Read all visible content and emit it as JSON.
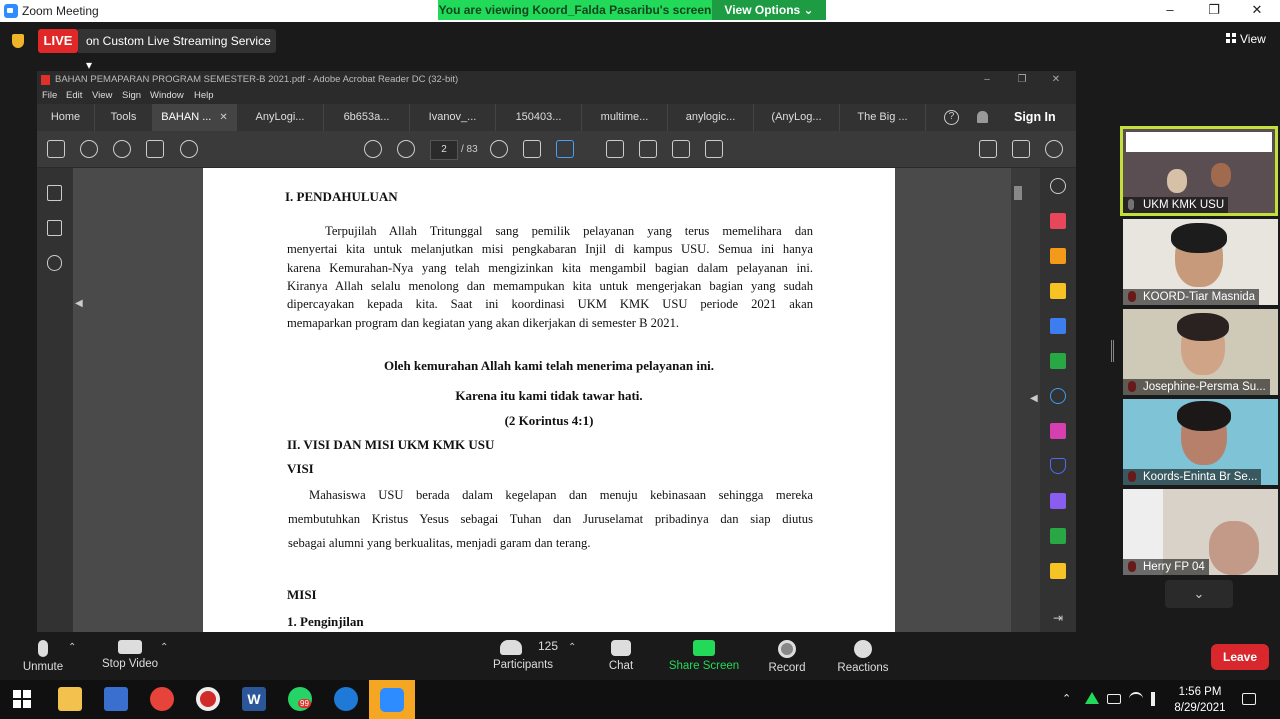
{
  "window": {
    "title": "Zoom Meeting",
    "minimize": "–",
    "restore": "❐",
    "close": "✕"
  },
  "banner": {
    "viewing": "You are viewing Koord_Falda Pasaribu's screen",
    "view_options": "View Options ⌄"
  },
  "live": {
    "badge": "LIVE",
    "stream": "on Custom Live Streaming Service  ▾"
  },
  "view_label": "View",
  "acrobat": {
    "title": "BAHAN PEMAPARAN PROGRAM SEMESTER-B 2021.pdf - Adobe Acrobat Reader DC (32-bit)",
    "menu": [
      "File",
      "Edit",
      "View",
      "Sign",
      "Window",
      "Help"
    ],
    "tabs": [
      "Home",
      "Tools",
      "BAHAN ...",
      "AnyLogi...",
      "6b653a...",
      "Ivanov_...",
      "150403...",
      "multime...",
      "anylogic...",
      "(AnyLog...",
      "The Big ..."
    ],
    "sign_in": "Sign In",
    "page_current": "2",
    "page_total": "/ 83"
  },
  "document": {
    "heading1": "I.  PENDAHULUAN",
    "para1": [
      "Terpujilah Allah Tritunggal sang pemilik pelayanan yang terus memelihara dan",
      "menyertai kita untuk melanjutkan misi pengkabaran Injil di kampus USU. Semua ini hanya",
      "karena Kemurahan-Nya yang telah mengizinkan kita mengambil bagian dalam pelayanan ini.",
      "Kiranya Allah selalu menolong dan memampukan kita untuk mengerjakan bagian yang sudah",
      "dipercayakan kepada kita. Saat ini koordinasi UKM KMK USU periode 2021 akan",
      "memaparkan program dan kegiatan yang akan dikerjakan di semester B 2021."
    ],
    "quote1": "Oleh kemurahan Allah kami telah menerima pelayanan ini.",
    "quote2": "Karena itu kami tidak tawar hati.",
    "quote_ref": "(2  Korintus 4:1)",
    "heading2": "II. VISI DAN MISI UKM KMK USU",
    "visi_label": "VISI",
    "visi": [
      "Mahasiswa USU berada dalam kegelapan dan menuju kebinasaan sehingga mereka",
      "membutuhkan Kristus Yesus sebagai Tuhan dan Juruselamat pribadinya dan siap diutus",
      "sebagai alumni yang berkualitas, menjadi garam dan terang."
    ],
    "misi_label": "MISI",
    "misi_item1": "1.  Penginjilan"
  },
  "participants": [
    {
      "name": "UKM KMK USU",
      "active": true
    },
    {
      "name": "KOORD-Tiar Masnida",
      "active": false
    },
    {
      "name": "Josephine-Persma Su...",
      "active": false
    },
    {
      "name": "Koords-Eninta Br Se...",
      "active": false
    },
    {
      "name": "Herry  FP 04",
      "active": false
    }
  ],
  "toolbar": {
    "unmute": "Unmute",
    "stop_video": "Stop Video",
    "participants": "Participants",
    "participants_count": "125",
    "chat": "Chat",
    "share_screen": "Share Screen",
    "record": "Record",
    "reactions": "Reactions",
    "leave": "Leave"
  },
  "taskbar": {
    "time": "1:56 PM",
    "date": "8/29/2021",
    "whatsapp_badge": "99"
  },
  "colors": {
    "live_red": "#e02828",
    "banner_green": "#23d959",
    "share_green": "#23d959",
    "leave_red": "#d9272e",
    "active_tile_border": "#c3df3a"
  }
}
